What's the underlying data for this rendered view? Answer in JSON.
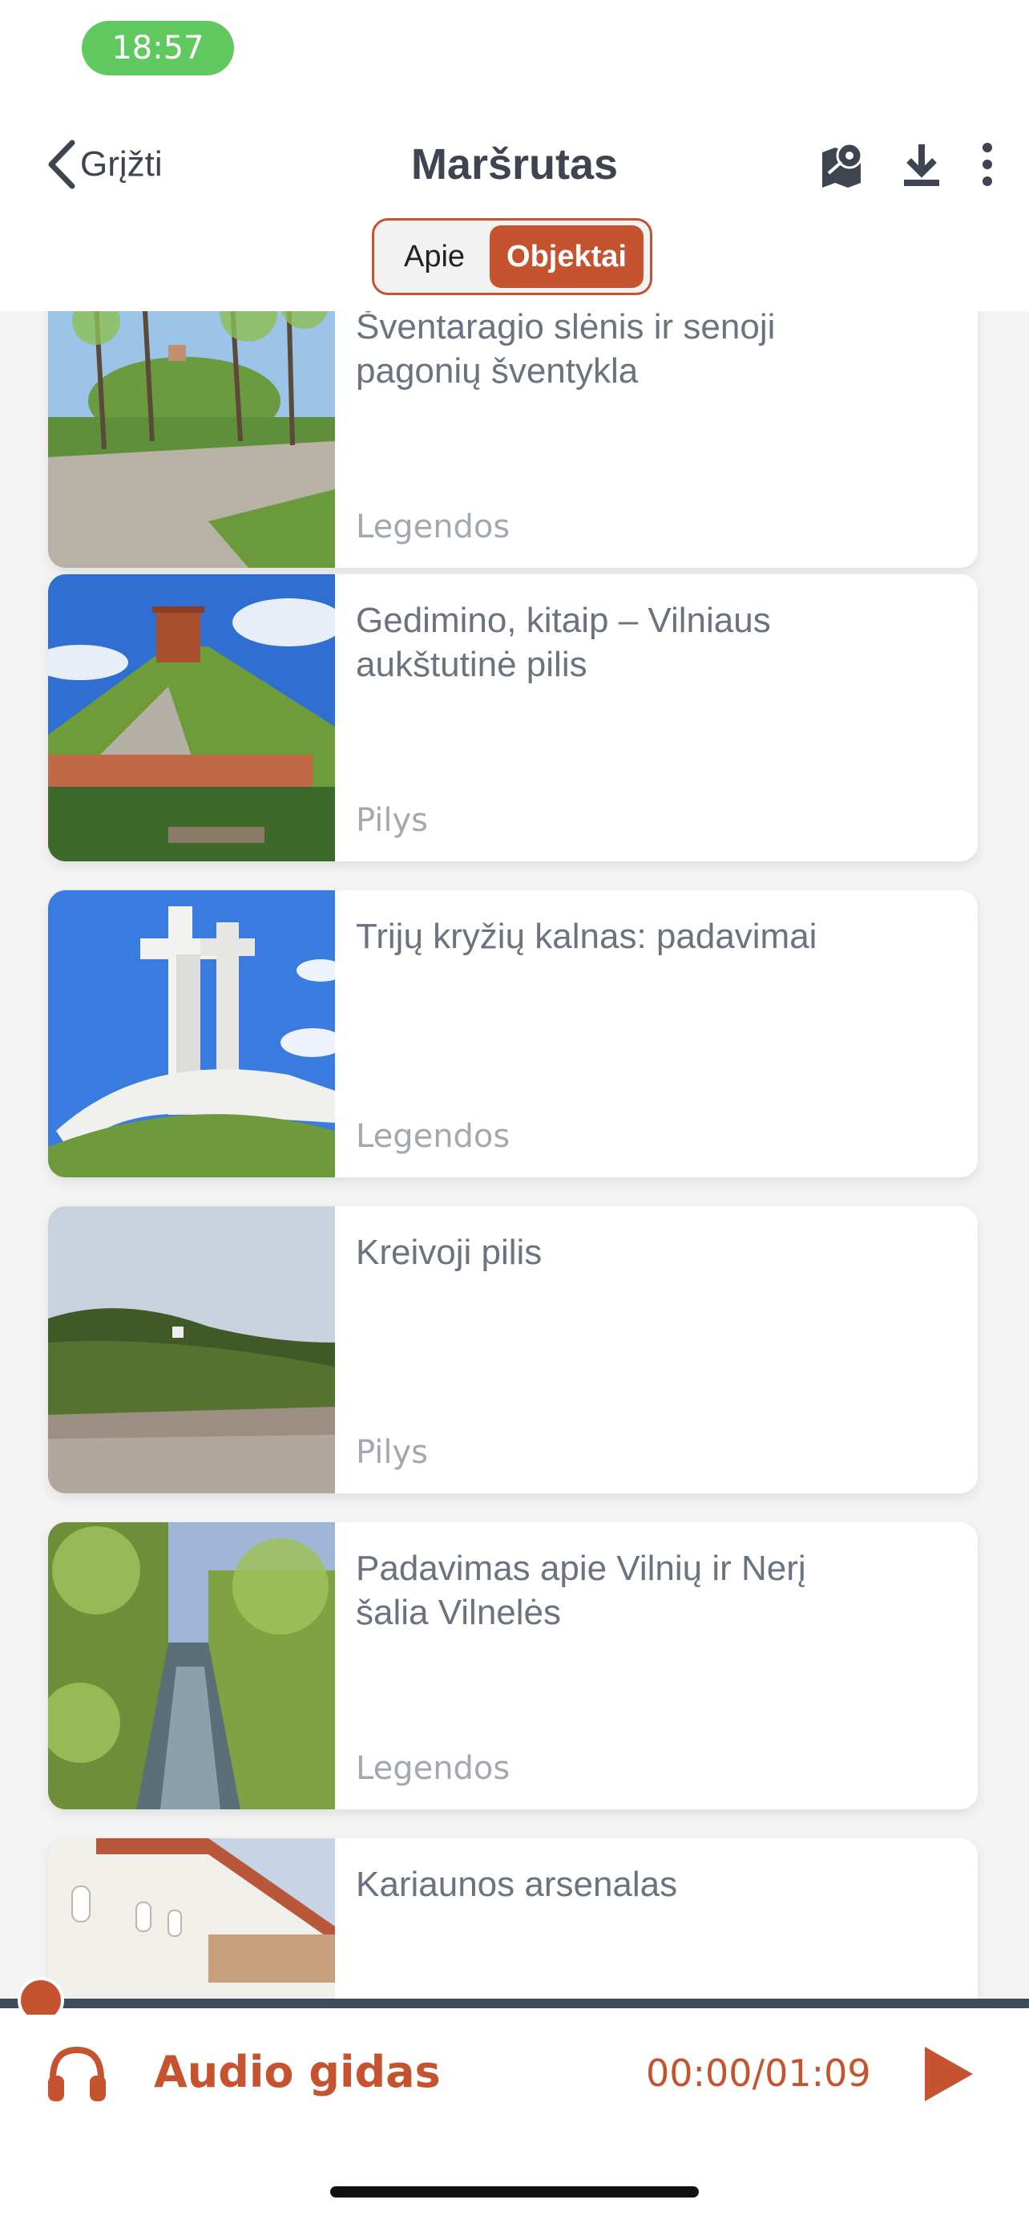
{
  "status": {
    "time": "18:57"
  },
  "nav": {
    "back_label": "Grįžti",
    "title": "Maršrutas"
  },
  "tabs": {
    "apie": "Apie",
    "objektai": "Objektai",
    "selected": "Objektai"
  },
  "items": [
    {
      "title": "Šventaragio slėnis ir senoji pagonių šventykla",
      "category": "Legendos",
      "thumb": "park-hill-icon"
    },
    {
      "title": "Gedimino, kitaip – Vilniaus aukštutinė pilis",
      "category": "Pilys",
      "thumb": "castle-tower-icon"
    },
    {
      "title": "Trijų kryžių kalnas: padavimai",
      "category": "Legendos",
      "thumb": "three-crosses-icon"
    },
    {
      "title": "Kreivoji pilis",
      "category": "Pilys",
      "thumb": "hill-ruins-icon"
    },
    {
      "title": "Padavimas apie Vilnių ir Nerį šalia Vilnelės",
      "category": "Legendos",
      "thumb": "river-icon"
    },
    {
      "title": "Kariaunos arsenalas",
      "category": "",
      "thumb": "arsenal-building-icon"
    }
  ],
  "audio": {
    "label": "Audio gidas",
    "time": "00:00/01:09",
    "progress": 0.0
  },
  "colors": {
    "accent": "#c65330",
    "status_green": "#5fc95f",
    "text_dark": "#3e4450",
    "text_item": "#6b7380",
    "text_category": "#a3a8b0"
  }
}
